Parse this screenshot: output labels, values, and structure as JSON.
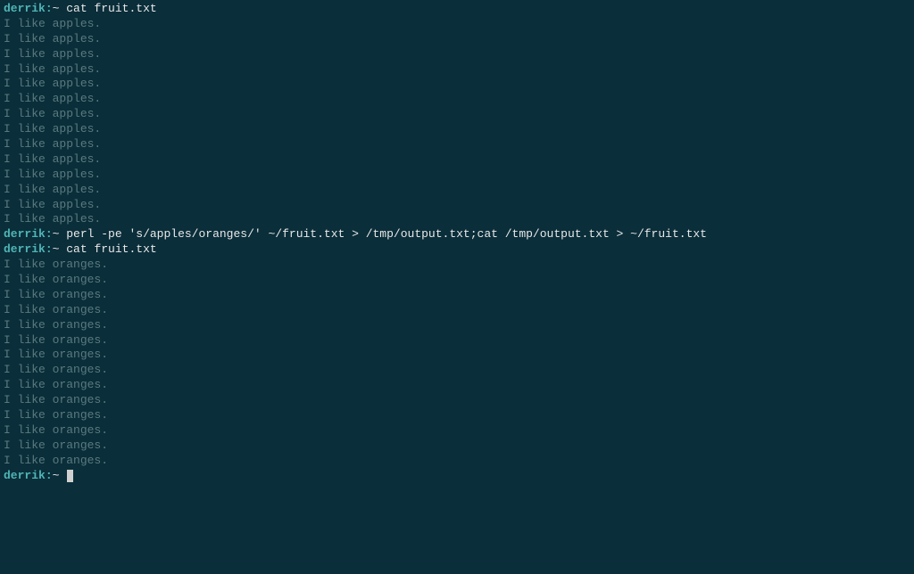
{
  "prompt": {
    "user": "derrik",
    "separator": ":",
    "path": "~",
    "symbol": " "
  },
  "blocks": [
    {
      "command": "cat fruit.txt",
      "output": [
        "I like apples.",
        "I like apples.",
        "I like apples.",
        "I like apples.",
        "I like apples.",
        "I like apples.",
        "I like apples.",
        "I like apples.",
        "I like apples.",
        "I like apples.",
        "I like apples.",
        "I like apples.",
        "I like apples.",
        "I like apples."
      ]
    },
    {
      "command": "perl -pe 's/apples/oranges/' ~/fruit.txt > /tmp/output.txt;cat /tmp/output.txt > ~/fruit.txt",
      "output": []
    },
    {
      "command": "cat fruit.txt",
      "output": [
        "I like oranges.",
        "I like oranges.",
        "I like oranges.",
        "I like oranges.",
        "I like oranges.",
        "I like oranges.",
        "I like oranges.",
        "I like oranges.",
        "I like oranges.",
        "I like oranges.",
        "I like oranges.",
        "I like oranges.",
        "I like oranges.",
        "I like oranges."
      ]
    }
  ]
}
